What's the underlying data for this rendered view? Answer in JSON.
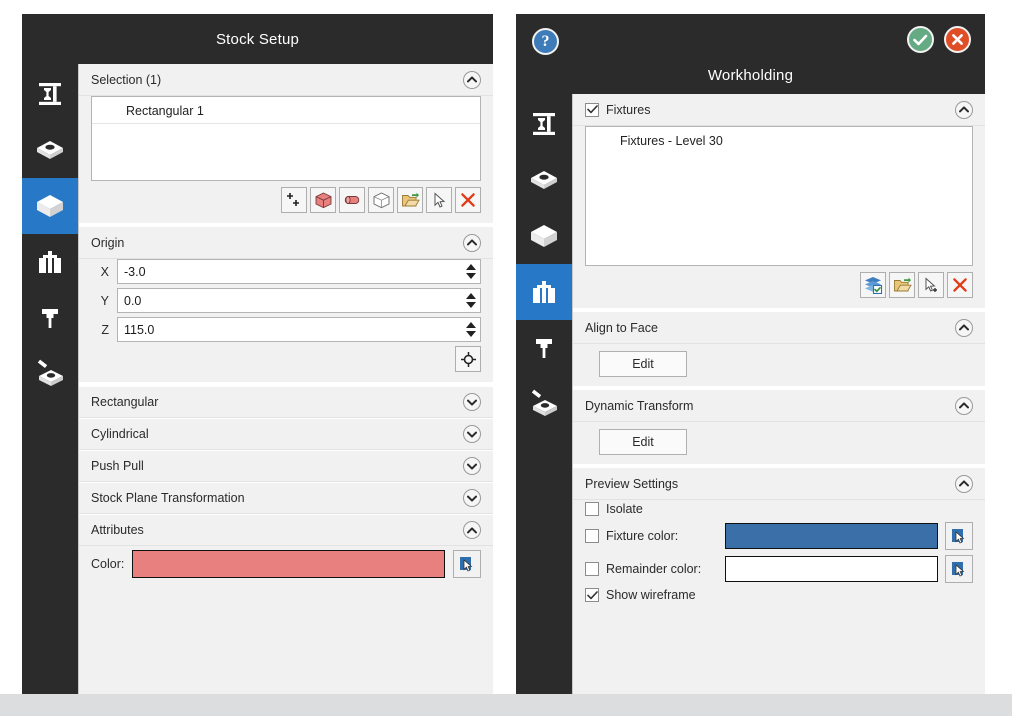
{
  "left_panel": {
    "title": "Stock Setup",
    "rail": [
      {
        "name": "setup-icon",
        "active": false
      },
      {
        "name": "model-icon",
        "active": false
      },
      {
        "name": "stock-icon",
        "active": true
      },
      {
        "name": "workholding-icon",
        "active": false
      },
      {
        "name": "tool-icon",
        "active": false
      },
      {
        "name": "machining-icon",
        "active": false
      }
    ],
    "sections": {
      "selection": {
        "title": "Selection (1)",
        "expanded": true,
        "items": [
          "Rectangular 1"
        ],
        "buttons": [
          {
            "name": "add-icon",
            "label": "Add"
          },
          {
            "name": "box-stock-icon",
            "label": "Box Stock"
          },
          {
            "name": "cylinder-stock-icon",
            "label": "Cylinder Stock"
          },
          {
            "name": "mesh-stock-icon",
            "label": "Mesh Stock"
          },
          {
            "name": "open-folder-icon",
            "label": "Import Stock"
          },
          {
            "name": "select-cursor-icon",
            "label": "Select"
          },
          {
            "name": "delete-x-icon",
            "label": "Delete"
          }
        ]
      },
      "origin": {
        "title": "Origin",
        "expanded": true,
        "fields": [
          {
            "label": "X",
            "value": "-3.0"
          },
          {
            "label": "Y",
            "value": "0.0"
          },
          {
            "label": "Z",
            "value": "115.0"
          }
        ],
        "pick_button": "crosshair-icon"
      },
      "rectangular": {
        "title": "Rectangular",
        "expanded": false
      },
      "cylindrical": {
        "title": "Cylindrical",
        "expanded": false
      },
      "push_pull": {
        "title": "Push Pull",
        "expanded": false
      },
      "stock_plane_transformation": {
        "title": "Stock Plane Transformation",
        "expanded": false
      },
      "attributes": {
        "title": "Attributes",
        "expanded": true,
        "color_label": "Color:",
        "color_value": "#e8807f",
        "pick_button": "color-picker-icon"
      }
    }
  },
  "right_panel": {
    "title": "Workholding",
    "header_buttons": [
      {
        "name": "help-icon",
        "glyph": "?"
      },
      {
        "name": "accept-icon",
        "glyph": "✔"
      },
      {
        "name": "cancel-icon",
        "glyph": "✖"
      }
    ],
    "rail": [
      {
        "name": "setup-icon",
        "active": false
      },
      {
        "name": "model-icon",
        "active": false
      },
      {
        "name": "stock-icon",
        "active": false
      },
      {
        "name": "workholding-icon",
        "active": true
      },
      {
        "name": "tool-icon",
        "active": false
      },
      {
        "name": "machining-icon",
        "active": false
      }
    ],
    "sections": {
      "fixtures": {
        "title": "Fixtures",
        "checked": true,
        "expanded": true,
        "items": [
          "Fixtures - Level 30"
        ],
        "buttons": [
          {
            "name": "select-layers-icon",
            "label": "Select Layers"
          },
          {
            "name": "open-folder-icon",
            "label": "Import Fixture"
          },
          {
            "name": "add-cursor-icon",
            "label": "Pick Fixture"
          },
          {
            "name": "delete-x-icon",
            "label": "Delete"
          }
        ]
      },
      "align_to_face": {
        "title": "Align to Face",
        "expanded": true,
        "edit_label": "Edit"
      },
      "dynamic_transform": {
        "title": "Dynamic Transform",
        "expanded": true,
        "edit_label": "Edit"
      },
      "preview_settings": {
        "title": "Preview Settings",
        "expanded": true,
        "isolate": {
          "label": "Isolate",
          "checked": false
        },
        "fixture_color": {
          "label": "Fixture color:",
          "checked": false,
          "value": "#3a6fa8"
        },
        "remainder_color": {
          "label": "Remainder color:",
          "checked": false,
          "value": "#ffffff"
        },
        "show_wireframe": {
          "label": "Show wireframe",
          "checked": true
        },
        "pick_button": "color-picker-icon"
      }
    }
  },
  "theme": {
    "panel_bg": "#2b2b2b",
    "accent": "#2878c8",
    "content_bg": "#f1f1f1",
    "page_bg": "#dcdddf"
  }
}
